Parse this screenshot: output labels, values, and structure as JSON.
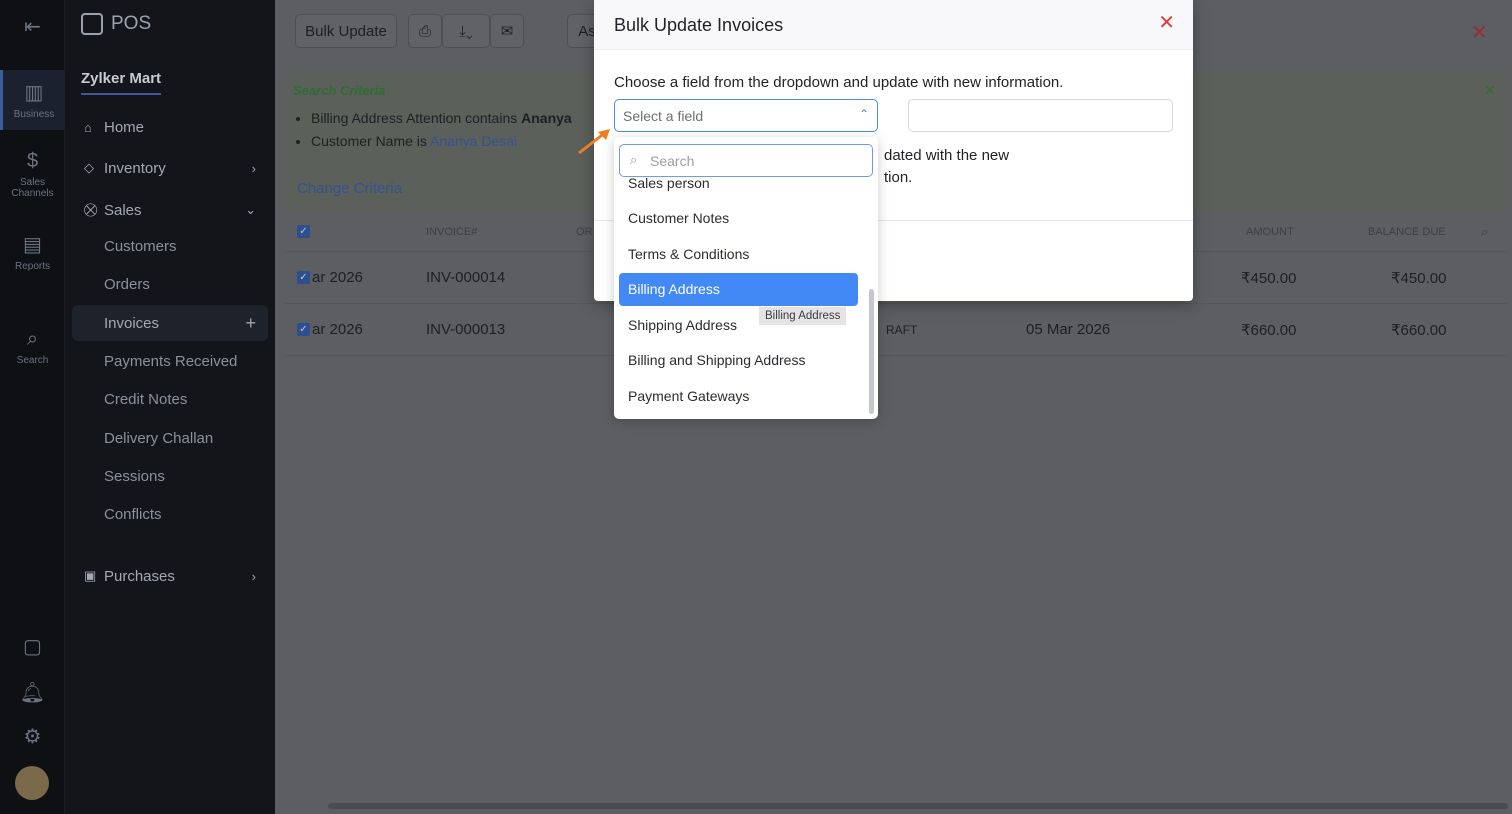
{
  "rail": {
    "items": [
      {
        "label": "Business",
        "icon": "building-icon"
      },
      {
        "label": "Sales Channels",
        "icon": "dollar-icon"
      },
      {
        "label": "Reports",
        "icon": "chart-icon"
      },
      {
        "label": "Search",
        "icon": "search-icon"
      }
    ]
  },
  "nav": {
    "app": "POS",
    "org": "Zylker Mart",
    "home": "Home",
    "inventory": "Inventory",
    "sales": "Sales",
    "sub": [
      "Customers",
      "Orders",
      "Invoices",
      "Payments Received",
      "Credit Notes",
      "Delivery Challan",
      "Sessions",
      "Conflicts"
    ],
    "purchases": "Purchases"
  },
  "toolbar": {
    "bulk_update": "Bulk Update",
    "as": "As"
  },
  "criteria": {
    "title": "Search Criteria",
    "c1_pre": "Billing Address Attention contains ",
    "c1_val": "Ananya",
    "c2_pre": "Customer Name is ",
    "c2_val": "Ananya Desai",
    "change": "Change Criteria"
  },
  "table": {
    "headers": {
      "invoice": "INVOICE#",
      "order": "OR",
      "amount": "AMOUNT",
      "balance": "BALANCE DUE"
    },
    "rows": [
      {
        "date": "ar 2026",
        "invoice": "INV-000014",
        "status": "",
        "date2": "",
        "amount": "₹450.00",
        "balance": "₹450.00"
      },
      {
        "date": "ar 2026",
        "invoice": "INV-000013",
        "status": "RAFT",
        "date2": "05 Mar 2026",
        "amount": "₹660.00",
        "balance": "₹660.00"
      }
    ]
  },
  "modal": {
    "title": "Bulk Update Invoices",
    "desc": "Choose a field from the dropdown and update with new information.",
    "select_placeholder": "Select a field",
    "note1": "dated with the new",
    "note2": "tion."
  },
  "dropdown": {
    "search_placeholder": "Search",
    "options": [
      "Sales person",
      "Customer Notes",
      "Terms & Conditions",
      "Billing Address",
      "Shipping Address",
      "Billing and Shipping Address",
      "Payment Gateways"
    ],
    "highlighted": "Billing Address",
    "tooltip": "Billing Address"
  }
}
